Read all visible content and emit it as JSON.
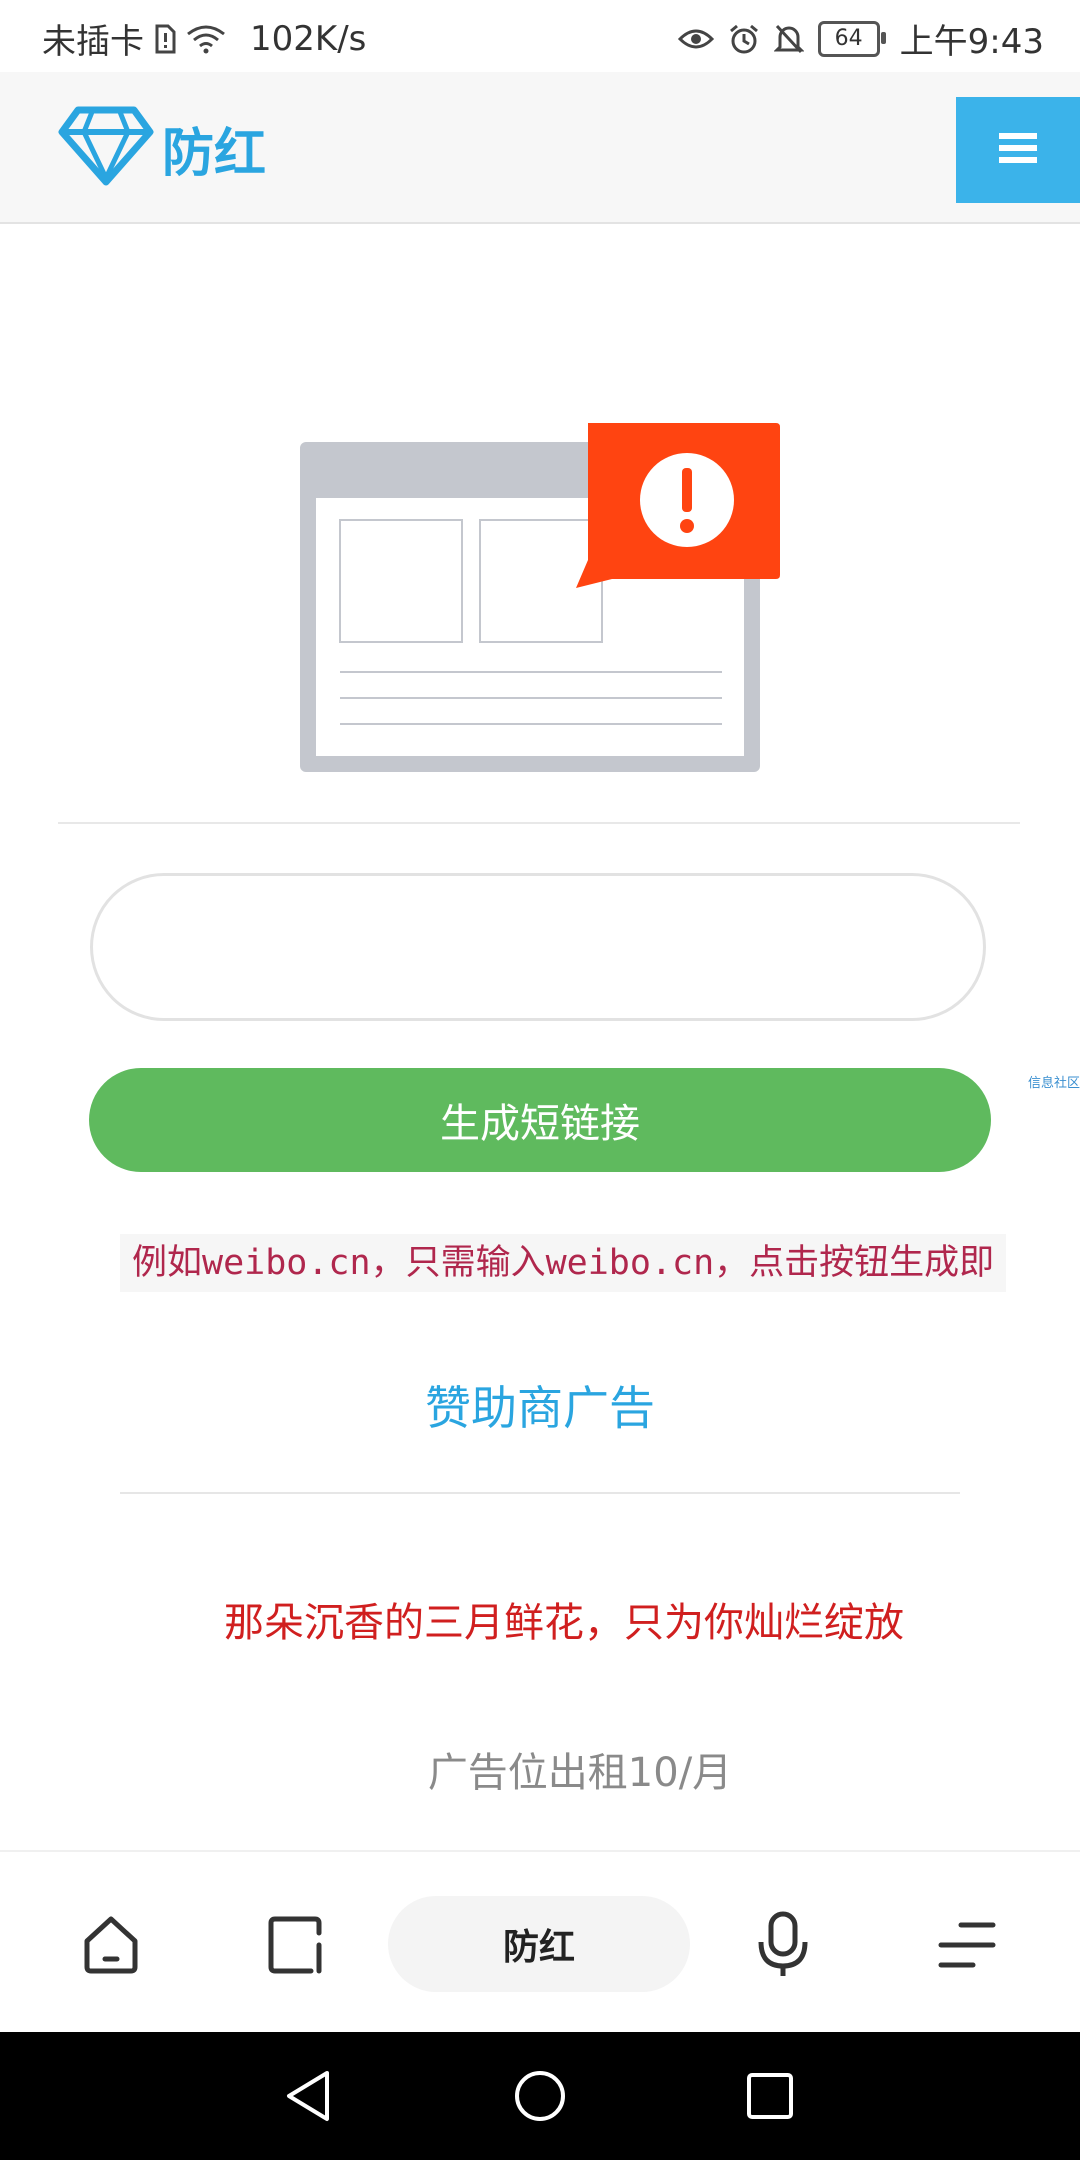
{
  "status_bar": {
    "carrier": "未插卡",
    "speed": "102K/s",
    "battery": "64",
    "time": "上午9:43"
  },
  "header": {
    "logo_text": "防红",
    "menu_icon": "hamburger-icon"
  },
  "illustration": {
    "icon": "warning-browser-icon",
    "alert_color": "#ff4411"
  },
  "form": {
    "url_value": "",
    "url_placeholder": "",
    "generate_label": "生成短链接",
    "side_tag": "信息社区"
  },
  "example_text": "例如weibo.cn，只需输入weibo.cn，点击按钮生成即",
  "sponsor_title": "赞助商广告",
  "ad_text": "那朵沉香的三月鲜花，只为你灿烂绽放",
  "ad_rent": "广告位出租10/月",
  "bottom_bar": {
    "pill_label": "防红",
    "icons": [
      "home-icon",
      "tabs-icon",
      "microphone-icon",
      "menu-icon"
    ]
  },
  "nav_bar": {
    "icons": [
      "back-icon",
      "home-circle-icon",
      "recents-icon"
    ]
  },
  "colors": {
    "accent": "#2aa5e0",
    "menu_button": "#3bb3ea",
    "generate_button": "#5fba5e",
    "ad_text": "#d01f1f",
    "example_text": "#b0274d"
  }
}
